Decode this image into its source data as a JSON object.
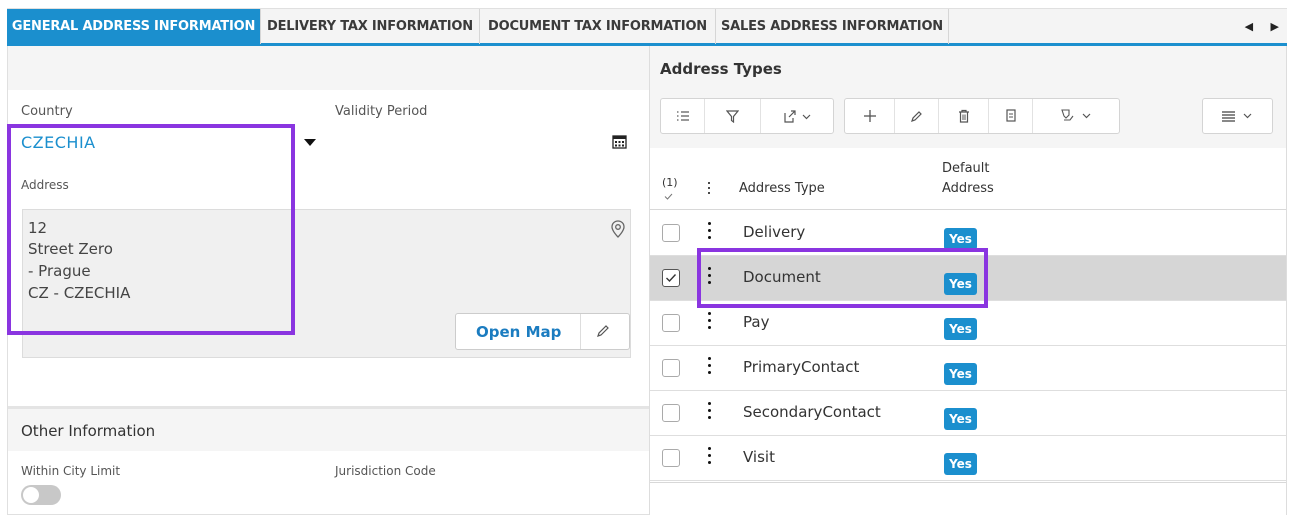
{
  "tabs": [
    {
      "label": "GENERAL ADDRESS INFORMATION",
      "active": true
    },
    {
      "label": "DELIVERY TAX INFORMATION",
      "active": false
    },
    {
      "label": "DOCUMENT TAX INFORMATION",
      "active": false
    },
    {
      "label": "SALES ADDRESS INFORMATION",
      "active": false
    }
  ],
  "tab_nav": {
    "prev": "◀",
    "next": "▶"
  },
  "general": {
    "country_label": "Country",
    "country_value": "CZECHIA",
    "validity_label": "Validity Period",
    "address_label": "Address",
    "address_lines": [
      "12",
      "Street Zero",
      "- Prague",
      "CZ - CZECHIA"
    ],
    "open_map_label": "Open Map"
  },
  "other": {
    "title": "Other Information",
    "within_city_label": "Within City Limit",
    "within_city_value": false,
    "jurisdiction_label": "Jurisdiction Code"
  },
  "address_types": {
    "title": "Address Types",
    "selected_count": "(1)",
    "col_type": "Address Type",
    "col_default_1": "Default",
    "col_default_2": "Address",
    "rows": [
      {
        "type": "Delivery",
        "default": "Yes",
        "selected": false
      },
      {
        "type": "Document",
        "default": "Yes",
        "selected": true
      },
      {
        "type": "Pay",
        "default": "Yes",
        "selected": false
      },
      {
        "type": "PrimaryContact",
        "default": "Yes",
        "selected": false
      },
      {
        "type": "SecondaryContact",
        "default": "Yes",
        "selected": false
      },
      {
        "type": "Visit",
        "default": "Yes",
        "selected": false
      }
    ]
  },
  "colors": {
    "accent": "#1b8fce",
    "highlight": "#8a35e0"
  }
}
